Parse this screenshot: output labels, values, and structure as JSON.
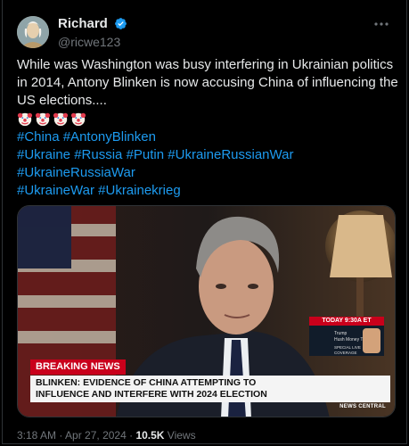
{
  "author": {
    "name": "Richard",
    "handle": "@ricwe123",
    "verified_icon": "verified-badge-icon",
    "avatar_icon": "avatar-portrait"
  },
  "more_icon": "more-options-icon",
  "tweet": {
    "lines": [
      "While was Washington was busy interfering in Ukrainian politics",
      "in 2014, Antony Blinken is now accusing China of influencing the",
      "US elections...."
    ],
    "emojis": [
      "clown-face-emoji",
      "clown-face-emoji",
      "clown-face-emoji",
      "clown-face-emoji"
    ],
    "hashtag_lines": [
      [
        "#China",
        "#AntonyBlinken"
      ],
      [
        "#Ukraine",
        "#Russia",
        "#Putin",
        "#UkraineRussianWar"
      ],
      [
        "#UkraineRussiaWar"
      ],
      [
        "#UkraineWar",
        "#Ukrainekrieg"
      ]
    ]
  },
  "media": {
    "breaking_label": "BREAKING NEWS",
    "headline_line1": "BLINKEN: EVIDENCE OF CHINA ATTEMPTING TO",
    "headline_line2": "INFLUENCE AND INTERFERE WITH 2024 ELECTION",
    "promo_time": "TODAY 9:30A ET",
    "promo_title1": "Trump",
    "promo_title2": "Hush Money Trial",
    "promo_subtitle": "SPECIAL LIVE COVERAGE",
    "network_label": "NEWS CENTRAL"
  },
  "footer": {
    "time": "3:18 AM",
    "sep": " · ",
    "date": "Apr 27, 2024",
    "views_count": "10.5K",
    "views_label": " Views"
  },
  "colors": {
    "accent": "#1d9bf0",
    "text": "#e7e9ea",
    "muted": "#71767b",
    "background": "#000000",
    "breaking_red": "#c9001b"
  }
}
